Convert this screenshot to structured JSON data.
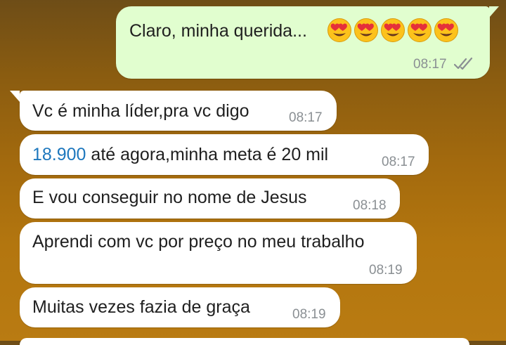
{
  "conversation": {
    "messages": [
      {
        "direction": "outgoing",
        "text": "Claro, minha querida...",
        "emoji": [
          "heart-eyes-emoji",
          "heart-eyes-emoji",
          "heart-eyes-emoji",
          "heart-eyes-emoji",
          "heart-eyes-emoji"
        ],
        "time": "08:17",
        "status": "read-double-check"
      },
      {
        "direction": "incoming",
        "text": "Vc é minha líder,pra vc digo",
        "time": "08:17"
      },
      {
        "direction": "incoming",
        "number": "18.900",
        "text": " até agora,minha meta é 20 mil",
        "time": "08:17"
      },
      {
        "direction": "incoming",
        "text": "E vou conseguir no nome de Jesus",
        "time": "08:18"
      },
      {
        "direction": "incoming",
        "text": "Aprendi com vc por preço no meu trabalho",
        "time": "08:19"
      },
      {
        "direction": "incoming",
        "text": "Muitas vezes fazia de graça",
        "time": "08:19"
      }
    ]
  },
  "colors": {
    "outgoing_bubble": "#e1fecf",
    "incoming_bubble": "#ffffff",
    "link": "#1d77bd",
    "timestamp": "#8a8f93",
    "background_top": "#6e4d17",
    "background_bottom": "#b97b12"
  }
}
